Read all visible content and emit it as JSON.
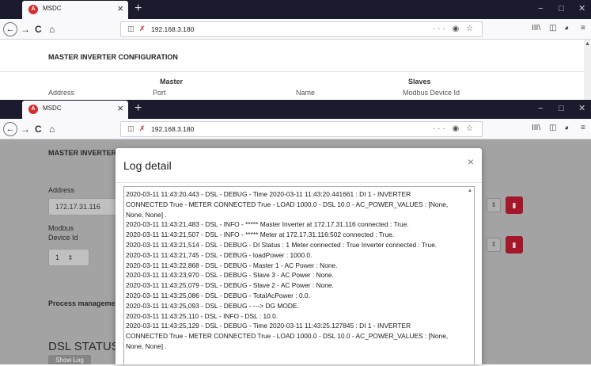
{
  "browser": {
    "tab_title": "MSDC",
    "tab_favicon": "A",
    "tab_close": "×",
    "new_tab": "+",
    "url": "192.168.3.180",
    "window_controls": {
      "minimize": "−",
      "maximize": "□",
      "close": "✕"
    }
  },
  "window1": {
    "heading": "MASTER INVERTER CONFIGURATION",
    "master_header": "Master",
    "slaves_header": "Slaves",
    "columns": [
      "Address",
      "Port",
      "Name",
      "Modbus Device Id"
    ]
  },
  "window2": {
    "background": {
      "heading": "MASTER INVERTER",
      "address_label": "Address",
      "address_value": "172.17.31.116",
      "modbus_label_line1": "Modbus",
      "modbus_label_line2": "Device Id",
      "modbus_value": "1",
      "process_label": "Process managemen",
      "dsl_status": "DSL STATUS",
      "show_log": "Show Log"
    },
    "modal": {
      "title": "Log detail",
      "close": "×",
      "log_lines": [
        "2020-03-11 11:43:20,443 - DSL - DEBUG - Time 2020-03-11 11:43:20.441661 : DI 1 - INVERTER",
        "CONNECTED True - METER CONNECTED True - LOAD 1000.0 - DSL 10.0 - AC_POWER_VALUES : [None,",
        "None, None] .",
        "2020-03-11 11:43:21,483 - DSL - INFO - ***** Master Inverter at 172.17.31.116 connected : True.",
        "2020-03-11 11:43:21,507 - DSL - INFO - ***** Meter at 172.17.31.116:502 connected : True.",
        "2020-03-11 11:43:21,514 - DSL - DEBUG - DI Status : 1 Meter connected : True Inverter connected : True.",
        "2020-03-11 11:43:21,745 - DSL - DEBUG - loadPower : 1000.0.",
        "2020-03-11 11:43:22,868 - DSL - DEBUG - Master 1 - AC Power : None.",
        "2020-03-11 11:43:23,970 - DSL - DEBUG - Slave 3  - AC Power : None.",
        "2020-03-11 11:43:25,079 - DSL - DEBUG - Slave 2  - AC Power : None.",
        "2020-03-11 11:43:25,086 - DSL - DEBUG - TotalAcPower : 0.0.",
        "2020-03-11 11:43:25,093 - DSL - DEBUG - ---> DG MODE.",
        "2020-03-11 11:43:25,110 - DSL - INFO - DSL : 10.0.",
        "2020-03-11 11:43:25,129 - DSL - DEBUG - Time 2020-03-11 11:43:25.127845 : DI 1 - INVERTER",
        "CONNECTED True - METER CONNECTED True - LOAD 1000.0 - DSL 10.0 - AC_POWER_VALUES : [None,",
        "None, None] ."
      ]
    }
  },
  "icons": {
    "back": "←",
    "forward": "→",
    "reload": "C",
    "home": "⌂",
    "shield": "◫",
    "lock": "✗",
    "url_actions": "··· ◉ ☆",
    "library": "III\\",
    "sidebar": "◫",
    "extension": "◕",
    "menu": "≡",
    "stepper": "⇕",
    "trash": "▮",
    "scroll_up": "▲"
  }
}
